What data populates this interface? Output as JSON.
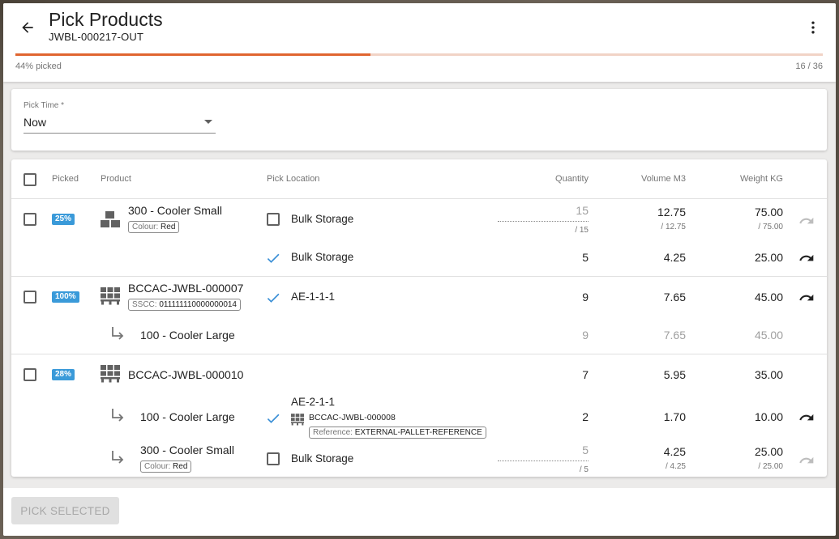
{
  "header": {
    "title": "Pick Products",
    "subtitle": "JWBL-000217-OUT",
    "progress_label": "44% picked",
    "progress_count": "16 / 36",
    "progress_fraction": 0.44
  },
  "pick_time": {
    "label": "Pick Time *",
    "value": "Now"
  },
  "table": {
    "headers": {
      "picked": "Picked",
      "product": "Product",
      "location": "Pick Location",
      "quantity": "Quantity",
      "volume": "Volume M3",
      "weight": "Weight KG"
    },
    "groups": [
      {
        "badge": "25%",
        "product": "300 - Cooler Small",
        "chip_key": "Colour:",
        "chip_value": "Red",
        "row1": {
          "location": "Bulk Storage",
          "qty": "15",
          "qty_total": "/ 15",
          "volume": "12.75",
          "volume_total": "/ 12.75",
          "weight": "75.00",
          "weight_total": "/ 75.00"
        },
        "row2": {
          "location": "Bulk Storage",
          "qty": "5",
          "volume": "4.25",
          "weight": "25.00"
        }
      },
      {
        "badge": "100%",
        "product": "BCCAC-JWBL-000007",
        "chip_key": "SSCC:",
        "chip_value": "011111110000000014",
        "location": "AE-1-1-1",
        "qty": "9",
        "volume": "7.65",
        "weight": "45.00",
        "child": {
          "product": "100 - Cooler Large",
          "qty": "9",
          "volume": "7.65",
          "weight": "45.00"
        }
      },
      {
        "badge": "28%",
        "product": "BCCAC-JWBL-000010",
        "qty": "7",
        "volume": "5.95",
        "weight": "35.00",
        "child1": {
          "product": "100 - Cooler Large",
          "location": "AE-2-1-1",
          "pallet": "BCCAC-JWBL-000008",
          "ref_key": "Reference:",
          "ref_value": "EXTERNAL-PALLET-REFERENCE",
          "qty": "2",
          "volume": "1.70",
          "weight": "10.00"
        },
        "child2": {
          "product": "300 - Cooler Small",
          "chip_key": "Colour:",
          "chip_value": "Red",
          "location": "Bulk Storage",
          "qty": "5",
          "qty_total": "/ 5",
          "volume": "4.25",
          "volume_total": "/ 4.25",
          "weight": "25.00",
          "weight_total": "/ 25.00"
        }
      }
    ]
  },
  "footer": {
    "button_label": "PICK SELECTED"
  },
  "colors": {
    "accent": "#e0652f",
    "badge": "#3a9ad9",
    "check": "#3a8fd6"
  }
}
